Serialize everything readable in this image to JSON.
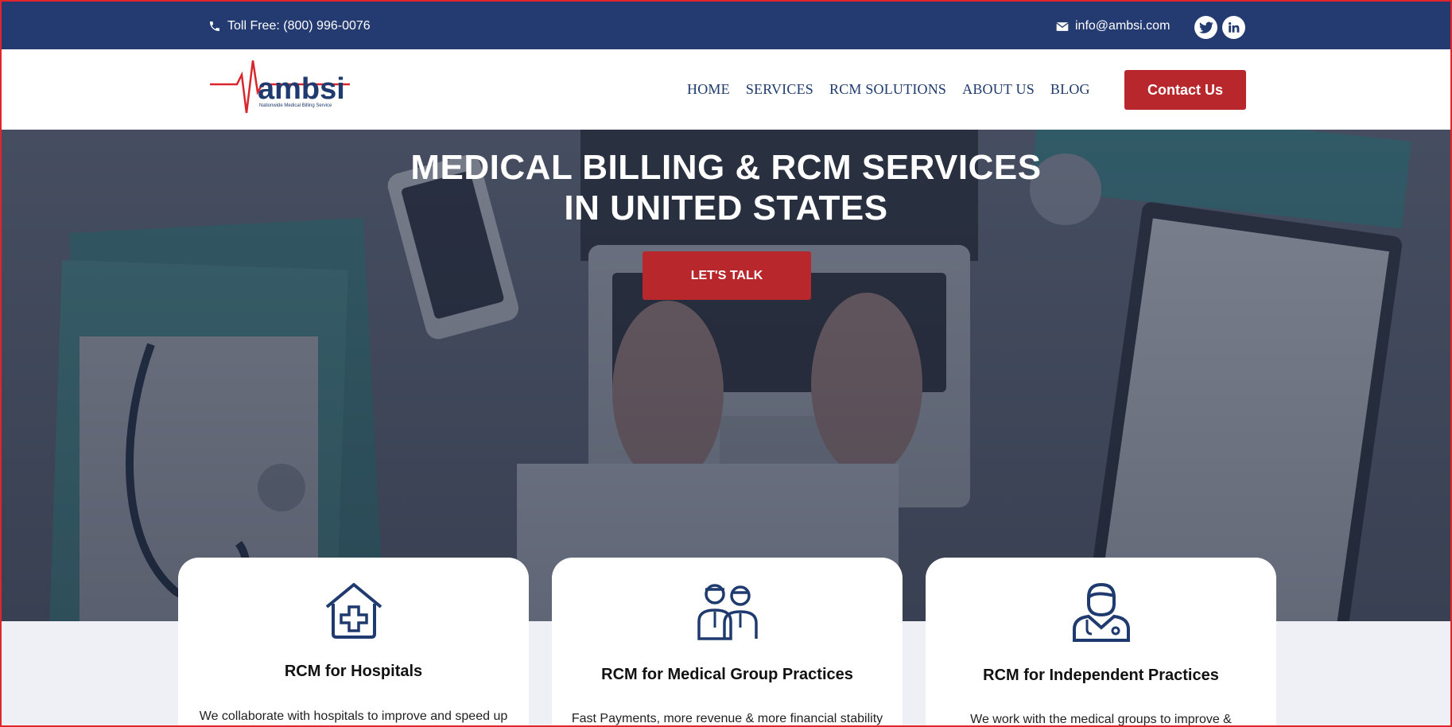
{
  "topbar": {
    "phone_label": "Toll Free: (800) 996-0076",
    "email_label": "info@ambsi.com",
    "social": [
      "twitter-icon",
      "linkedin-icon"
    ]
  },
  "header": {
    "logo_text": "ambsi",
    "logo_tagline": "Nationwide Medical Billing Service",
    "nav": [
      "HOME",
      "SERVICES",
      "RCM SOLUTIONS",
      "ABOUT US",
      "BLOG"
    ],
    "contact_label": "Contact Us"
  },
  "hero": {
    "title_line1": "MEDICAL BILLING & RCM SERVICES",
    "title_line2": "IN UNITED STATES",
    "cta_label": "LET'S TALK"
  },
  "cards": [
    {
      "title": "RCM for Hospitals",
      "text": "We collaborate with hospitals to improve and speed up",
      "icon": "hospital-house-icon"
    },
    {
      "title": "RCM for Medical Group Practices",
      "text": "Fast Payments, more revenue & more financial stability",
      "icon": "medical-team-icon"
    },
    {
      "title": "RCM for Independent Practices",
      "text": "We work with the medical groups to improve &",
      "icon": "doctor-icon"
    }
  ],
  "colors": {
    "navy": "#243b71",
    "accent_red": "#b8272b",
    "nav_text": "#1f3a6e"
  }
}
